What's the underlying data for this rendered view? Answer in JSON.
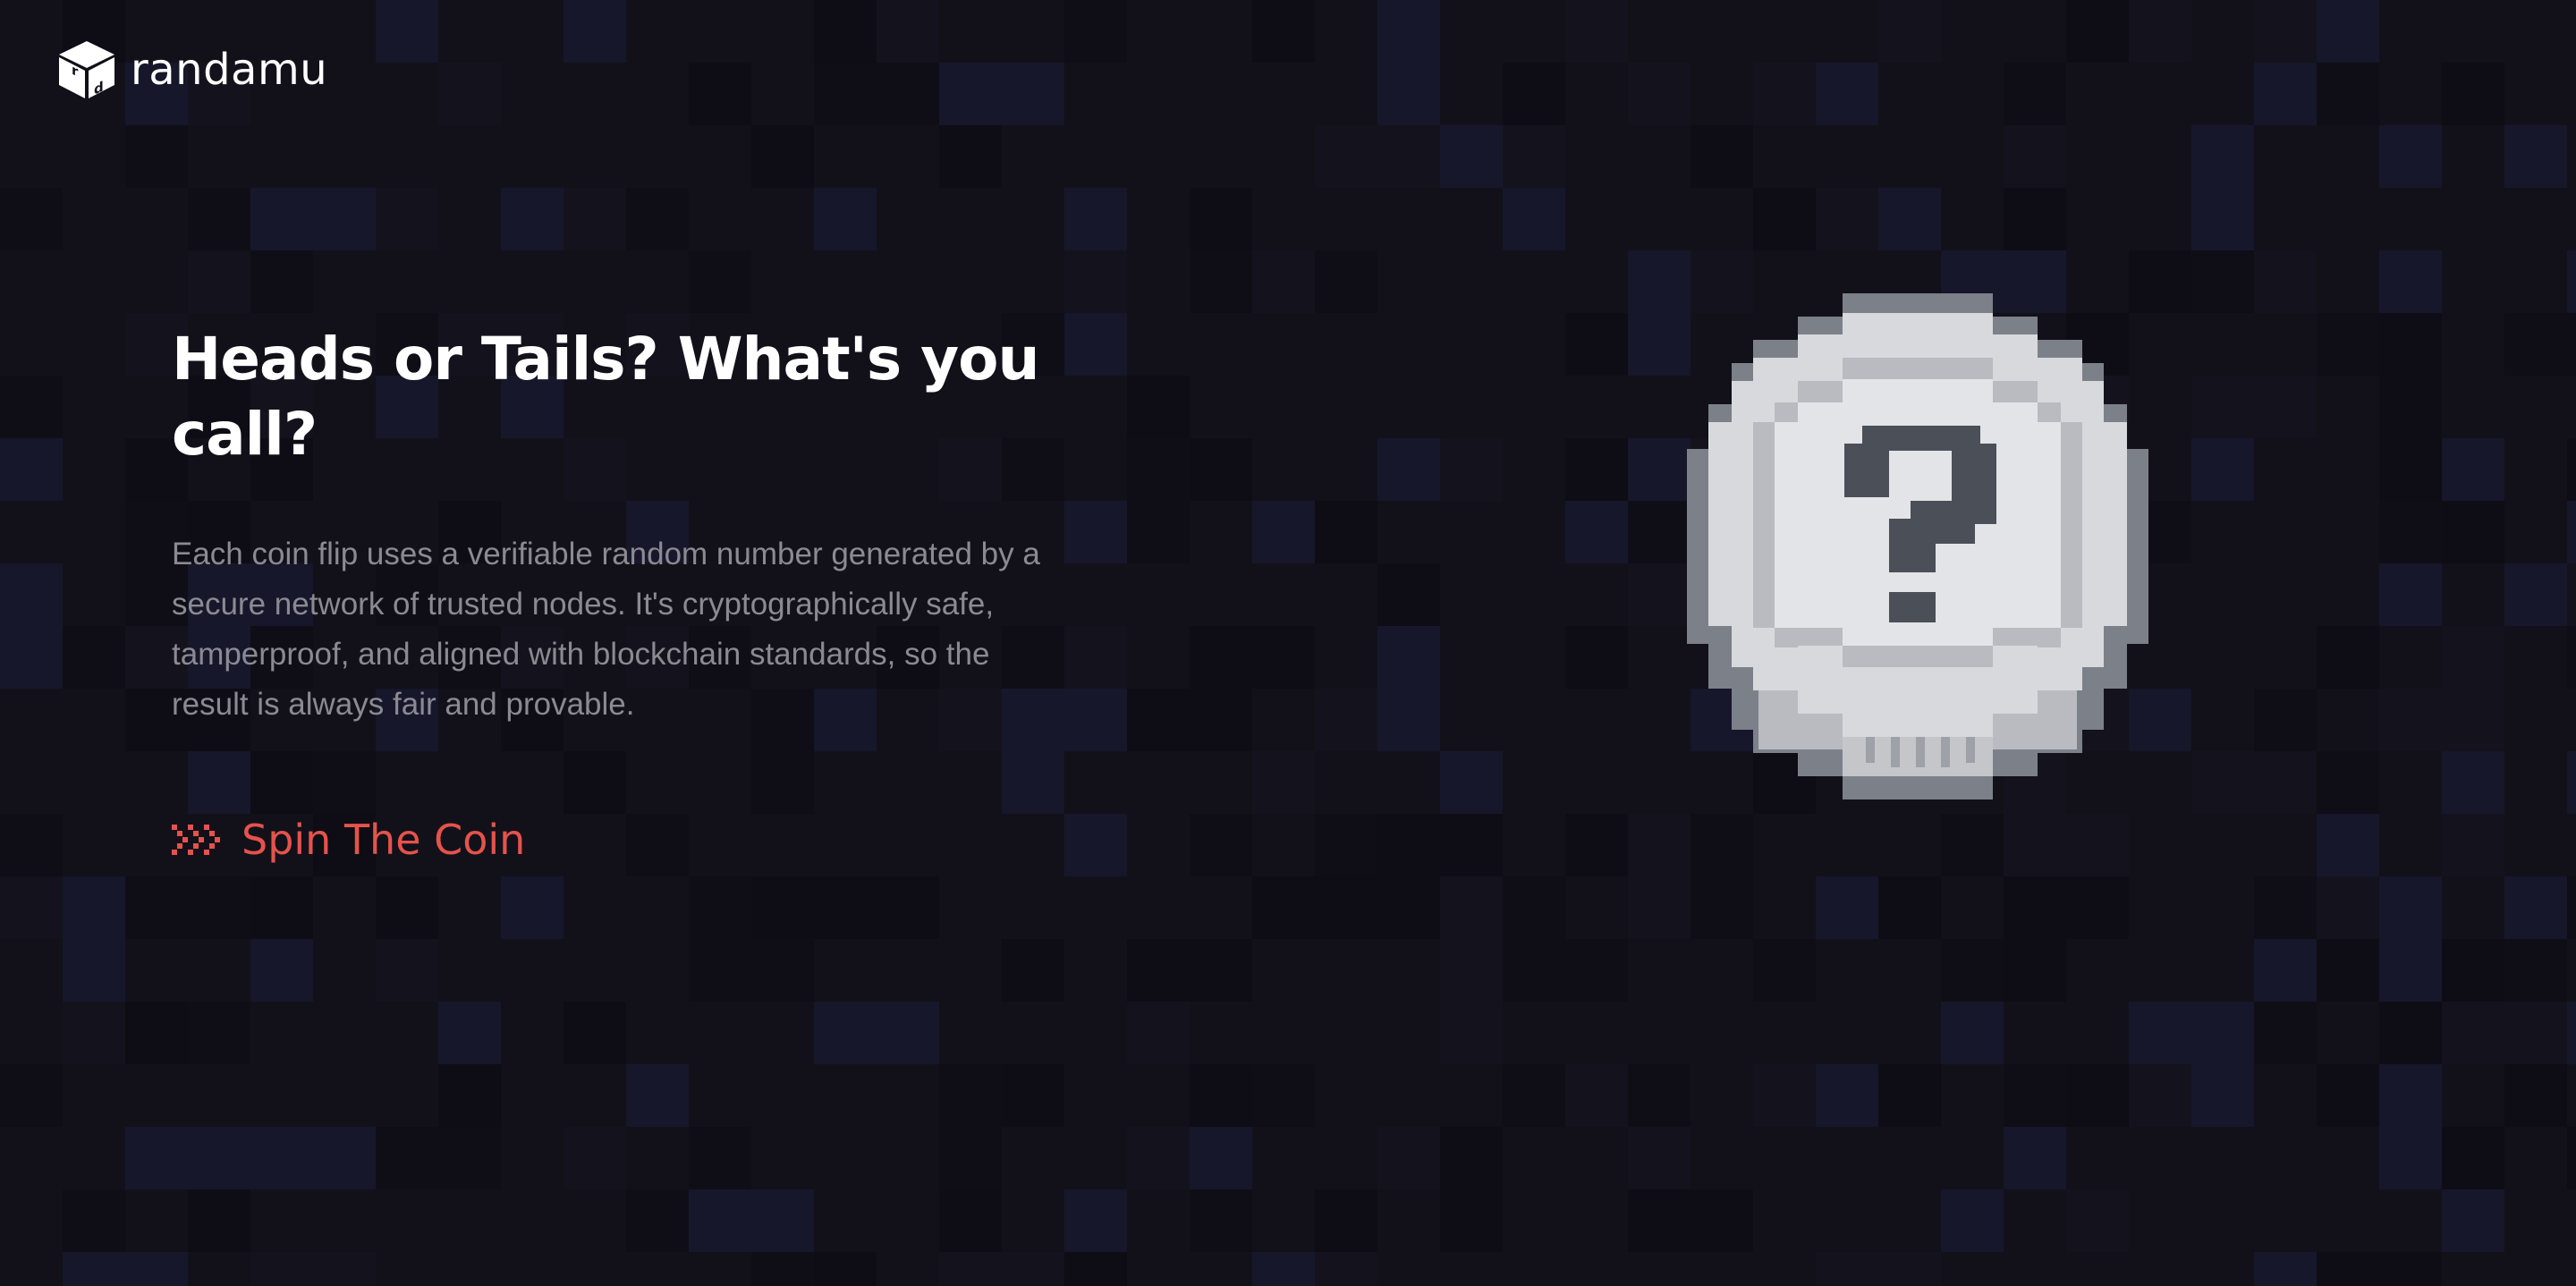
{
  "header": {
    "brand_name": "randamu",
    "logo_icon": "cube-logo-icon"
  },
  "hero": {
    "title": "Heads or Tails? What's you call?",
    "description": "Each coin flip uses a verifiable random number generated by a secure network of trusted nodes. It's cryptographically safe, tamperproof, and aligned with blockchain standards, so the result is always fair and provable.",
    "cta": {
      "label": "Spin The Coin",
      "icon": "triple-chevron-right-icon"
    }
  },
  "coin": {
    "icon": "question-mark-icon",
    "state": "unflipped"
  },
  "colors": {
    "background": "#12111a",
    "accent": "#e5534b",
    "text_primary": "#ffffff",
    "text_secondary": "#8b8a93",
    "coin_light": "#e2e3e6",
    "coin_mid": "#b9bbc0",
    "coin_dark": "#7c8089",
    "coin_glyph": "#4a4f58"
  }
}
